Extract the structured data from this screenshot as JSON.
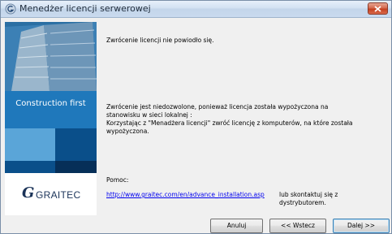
{
  "window": {
    "title": "Menedżer licencji serwerowej"
  },
  "sidebar": {
    "tagline": "Construction first",
    "logo_letter": "G",
    "logo_text": "GRAITEC"
  },
  "content": {
    "message_primary": "Zwrócenie licencji nie powiodło się.",
    "message_detail": "Zwrócenie jest niedozwolone, ponieważ licencja została wypożyczona na\nstanowisku w sieci lokalnej :\nKorzystając z \"Menadżera licencji\" zwróć licencję z komputerów, na które została\nwypożyczona.",
    "help_label": "Pomoc:",
    "help_link": "http://www.graitec.com/en/advance_installation.asp",
    "help_alt": "lub skontaktuj się z dystrybutorem."
  },
  "buttons": {
    "cancel": "Anuluj",
    "back": "<< Wstecz",
    "next": "Dalej >>"
  },
  "colors": {
    "sidebar_blue": "#1f78bb",
    "link": "#0000ee",
    "close_red": "#c4401f"
  }
}
